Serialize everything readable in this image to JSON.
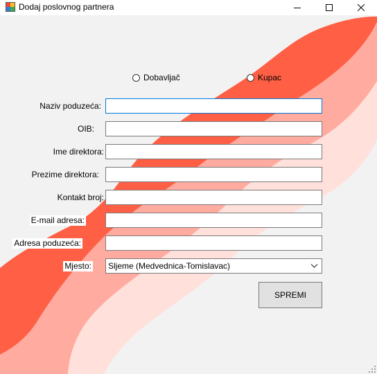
{
  "window": {
    "title": "Dodaj poslovnog partnera"
  },
  "partner_type": {
    "options": [
      "Dobavljač",
      "Kupac"
    ]
  },
  "form": {
    "fields": [
      {
        "label": "Naziv poduzeća:",
        "value": ""
      },
      {
        "label": "OIB:",
        "value": ""
      },
      {
        "label": "Ime direktora:",
        "value": ""
      },
      {
        "label": "Prezime direktora:",
        "value": ""
      },
      {
        "label": "Kontakt broj:",
        "value": ""
      },
      {
        "label": "E-mail adresa:",
        "value": ""
      },
      {
        "label": "Adresa poduzeća:",
        "value": ""
      }
    ],
    "city_label": "Mjesto:",
    "city_value": "Sljeme (Medvednica-Tomislavac)",
    "save_label": "SPREMI"
  },
  "colors": {
    "client_bg": "#f2f2f2",
    "wave_dark": "#ff5f45",
    "wave_mid": "#ffaba0",
    "wave_light": "#ffe0da",
    "focus_border": "#0078d7"
  }
}
